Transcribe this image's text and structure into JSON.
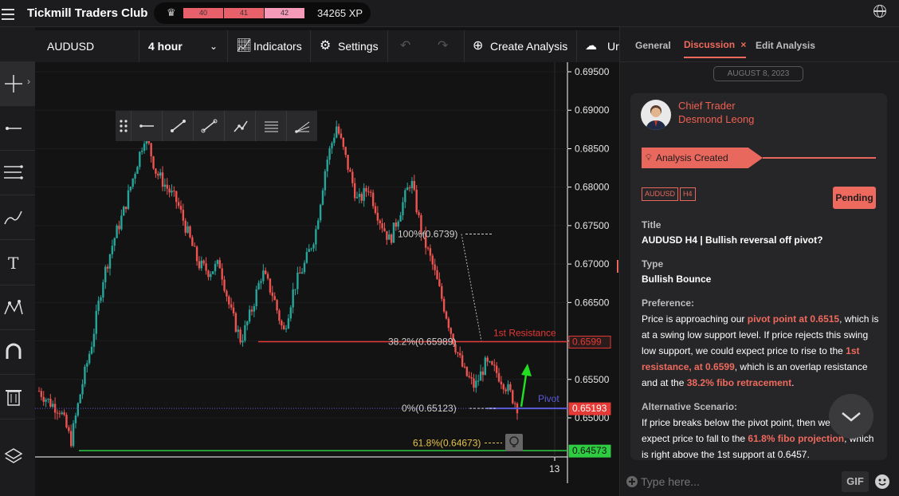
{
  "app": {
    "title": "Tickmill Traders Club",
    "levels": [
      "40",
      "41",
      "42"
    ],
    "xp": "34265 XP"
  },
  "toolbar": {
    "symbol": "AUDUSD",
    "timeframe": "4 hour",
    "indicators": "Indicators",
    "settings": "Settings",
    "create": "Create Analysis",
    "upload": "Ur"
  },
  "chart_data": {
    "type": "candlestick",
    "symbol": "AUDUSD",
    "timeframe": "4 hour",
    "ylim": [
      0.6445,
      0.6953
    ],
    "y_ticks": [
      "0.69500",
      "0.69000",
      "0.68500",
      "0.68000",
      "0.67500",
      "0.67000",
      "0.66500",
      "0.66000",
      "0.65500",
      "0.65000"
    ],
    "x_tick": "13",
    "price_path": [
      0.6535,
      0.652,
      0.651,
      0.647,
      0.654,
      0.66,
      0.668,
      0.673,
      0.677,
      0.682,
      0.687,
      0.682,
      0.68,
      0.678,
      0.674,
      0.67,
      0.669,
      0.67,
      0.664,
      0.66,
      0.664,
      0.669,
      0.666,
      0.661,
      0.667,
      0.67,
      0.674,
      0.683,
      0.688,
      0.683,
      0.678,
      0.68,
      0.676,
      0.673,
      0.677,
      0.681,
      0.674,
      0.67,
      0.665,
      0.66,
      0.656,
      0.654,
      0.657,
      0.656,
      0.654,
      0.6515
    ],
    "levels": [
      {
        "name": "1st Resistance",
        "value": 0.6599,
        "color": "#e53935",
        "tag": "0.6599"
      },
      {
        "name": "Pivot",
        "value": 0.65123,
        "color": "#5a5ad6",
        "tag": "0.65193"
      },
      {
        "name": "",
        "value": 0.64573,
        "color": "#2ecc40",
        "tag": "0.64573"
      }
    ],
    "fib": [
      {
        "text": "100%(0.6739)",
        "value": 0.6739
      },
      {
        "text": "38.2%(0.65989)",
        "value": 0.65989
      },
      {
        "text": "0%(0.65123)",
        "value": 0.65123
      },
      {
        "text": "61.8%(0.64673)",
        "value": 0.64673
      }
    ],
    "price_labels": {
      "resistance": "0.6599",
      "pivot": "0.65193",
      "support": "0.64573"
    }
  },
  "panel": {
    "tabs": [
      "General",
      "Discussion",
      "Edit Analysis"
    ],
    "date": "AUGUST 8, 2023",
    "role": "Chief Trader",
    "author": "Desmond Leong",
    "banner": "Analysis Created",
    "tags": [
      "AUDUSD",
      "H4"
    ],
    "status": "Pending",
    "title_label": "Title",
    "title_value": "AUDUSD H4 | Bullish reversal off pivot?",
    "type_label": "Type",
    "type_value": "Bullish Bounce",
    "pref_label": "Preference:",
    "pref_1": "Price is approaching our ",
    "pref_2": "pivot point at 0.6515",
    "pref_3": ", which is at a swing low support level. If price rejects this swing low support, we could expect price to rise to the ",
    "pref_4": "1st resistance, at 0.6599",
    "pref_5": ", which is an overlap resistance and at the ",
    "pref_6": "38.2% fibo retracement",
    "pref_7": ".",
    "alt_label": "Alternative Scenario:",
    "alt_1": "If price breaks below the pivot point, then we could expect price to fall to the ",
    "alt_2": "61.8% fibo projection",
    "alt_3": ", which is right above the 1st support at 0.6457.",
    "input_placeholder": "Type here...",
    "gif": "GIF"
  }
}
